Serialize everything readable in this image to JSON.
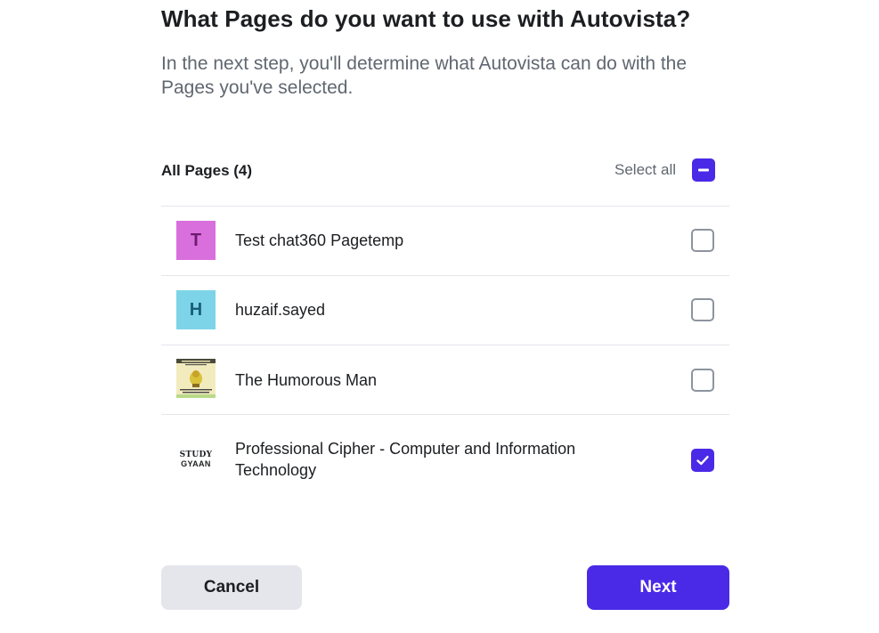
{
  "dialog": {
    "title": "What Pages do you want to use with Autovista?",
    "subtitle": "In the next step, you'll determine what Autovista can do with the Pages you've selected."
  },
  "list": {
    "title": "All Pages (4)",
    "select_all_label": "Select all",
    "select_all_state": "indeterminate",
    "pages": [
      {
        "name": "Test chat360 Pagetemp",
        "avatar_letter": "T",
        "avatar_bg": "#d96fdc",
        "avatar_fg": "#6b1b6e",
        "checked": false
      },
      {
        "name": "huzaif.sayed",
        "avatar_letter": "H",
        "avatar_bg": "#7dd4e8",
        "avatar_fg": "#1a5f7a",
        "checked": false
      },
      {
        "name": "The Humorous Man",
        "avatar_letter": "",
        "avatar_image": "meme-thumbnail",
        "checked": false
      },
      {
        "name": "Professional Cipher - Computer and Information Technology",
        "avatar_logo_line1": "STUDY",
        "avatar_logo_line2": "GYAAN",
        "checked": true
      }
    ]
  },
  "actions": {
    "cancel_label": "Cancel",
    "next_label": "Next"
  },
  "colors": {
    "accent": "#4a2ae6",
    "muted_text": "#606770",
    "divider": "#e4e6eb"
  }
}
